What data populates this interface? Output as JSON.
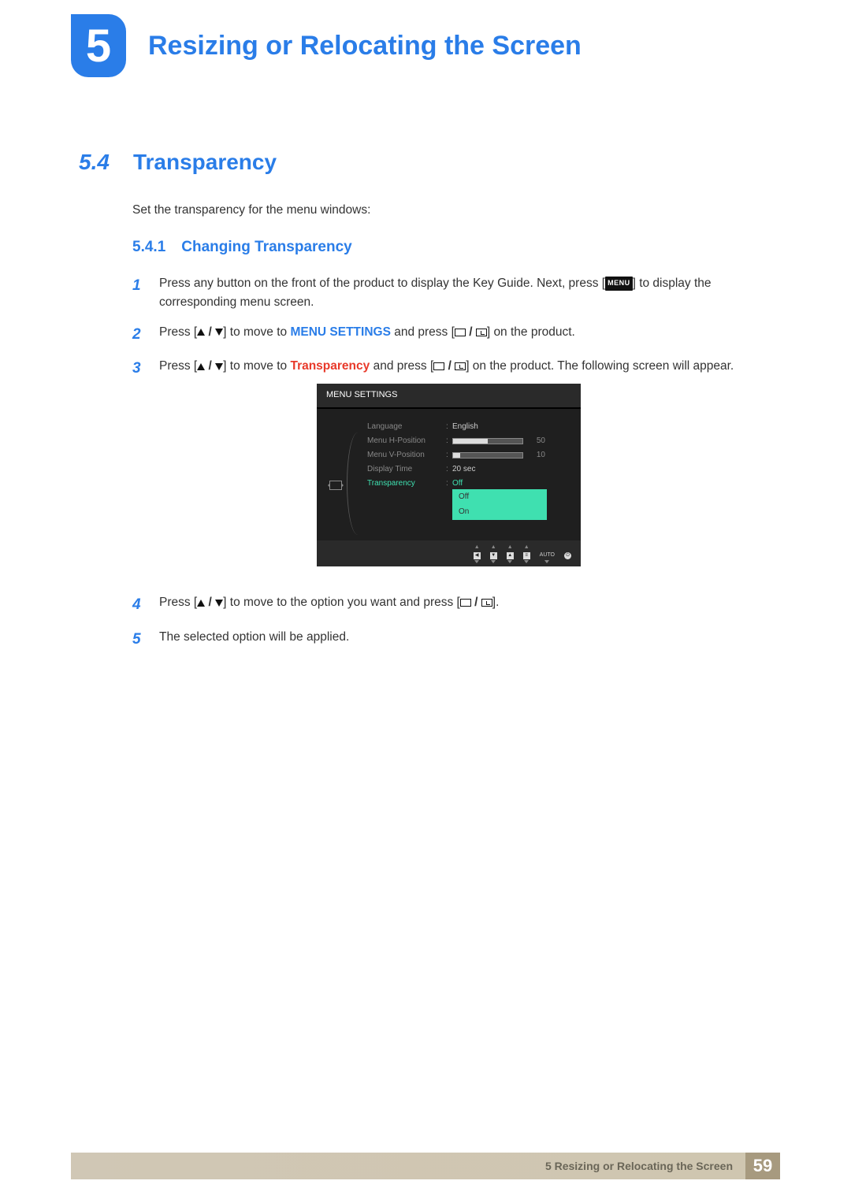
{
  "chapter": {
    "number": "5",
    "title": "Resizing or Relocating the Screen"
  },
  "section": {
    "number": "5.4",
    "title": "Transparency"
  },
  "intro": "Set the transparency for the menu windows:",
  "subsection": {
    "number": "5.4.1",
    "title": "Changing Transparency"
  },
  "steps": {
    "s1_a": "Press any button on the front of the product to display the Key Guide. Next, press [",
    "s1_menu": "MENU",
    "s1_b": "] to display the corresponding menu screen.",
    "s2_a": "Press [",
    "s2_b": "] to move to ",
    "s2_hl": "MENU SETTINGS",
    "s2_c": " and press [",
    "s2_d": "] on the product.",
    "s3_a": "Press [",
    "s3_b": "] to move to ",
    "s3_hl": "Transparency",
    "s3_c": " and press [",
    "s3_d": "] on the product. The following screen will appear.",
    "s4_a": "Press [",
    "s4_b": "] to move to the option you want and press [",
    "s4_c": "].",
    "s5": "The selected option will be applied."
  },
  "osd": {
    "title": "MENU SETTINGS",
    "rows": {
      "language": {
        "label": "Language",
        "value": "English"
      },
      "hpos": {
        "label": "Menu H-Position",
        "value": "50"
      },
      "vpos": {
        "label": "Menu V-Position",
        "value": "10"
      },
      "disptime": {
        "label": "Display Time",
        "value": "20 sec"
      },
      "transparency": {
        "label": "Transparency",
        "value": "Off"
      }
    },
    "dropdown": {
      "opt1": "Off",
      "opt2": "On"
    },
    "buttons": {
      "auto": "AUTO"
    }
  },
  "footer": {
    "text": "5 Resizing or Relocating the Screen",
    "page": "59"
  }
}
